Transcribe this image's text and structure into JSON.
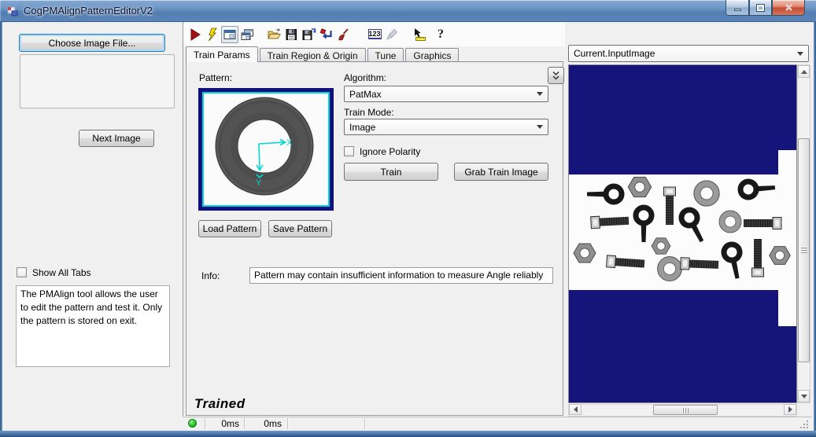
{
  "window": {
    "title": "CogPMAlignPatternEditorV2"
  },
  "toolbar": {
    "num_icon_glyph": "123",
    "help_glyph": "?"
  },
  "left_panel": {
    "choose_image_button": "Choose Image File...",
    "next_image_button": "Next Image",
    "show_all_tabs_label": "Show All Tabs",
    "description": "The PMAlign tool allows the user to edit the pattern and test it. Only the pattern is stored on exit."
  },
  "tabs": [
    {
      "label": "Train Params"
    },
    {
      "label": "Train Region & Origin"
    },
    {
      "label": "Tune"
    },
    {
      "label": "Graphics"
    }
  ],
  "train_params": {
    "pattern_label": "Pattern:",
    "algorithm_label": "Algorithm:",
    "algorithm_value": "PatMax",
    "train_mode_label": "Train Mode:",
    "train_mode_value": "Image",
    "ignore_polarity_label": "Ignore Polarity",
    "train_button": "Train",
    "grab_train_image_button": "Grab Train Image",
    "load_pattern_button": "Load Pattern",
    "save_pattern_button": "Save Pattern",
    "info_label": "Info:",
    "info_value": "Pattern may contain insufficient information to measure Angle reliably",
    "axis_x": "X",
    "axis_y": "Y"
  },
  "footer": {
    "trained_status": "Trained"
  },
  "status_bar": {
    "run_time": "0ms",
    "total_time": "0ms"
  },
  "right_panel": {
    "image_selector_value": "Current.InputImage"
  },
  "colors": {
    "navy": "#14147a",
    "cyan": "#00d8d8",
    "status_green": "#18b418",
    "titlebar_blue": "#5c86b8"
  }
}
